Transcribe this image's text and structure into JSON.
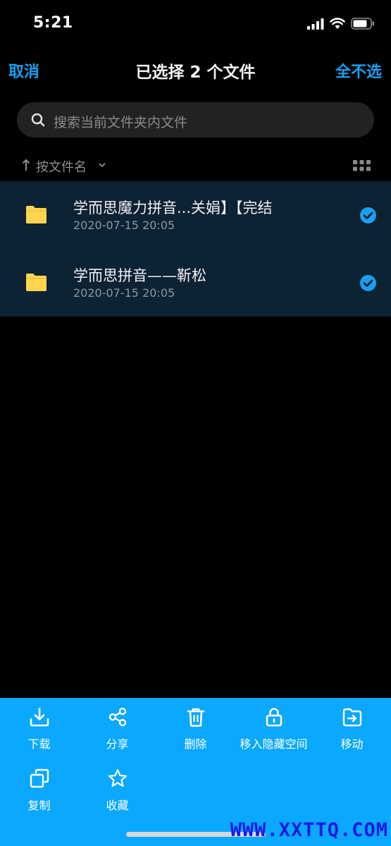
{
  "status_bar": {
    "time": "5:21"
  },
  "nav": {
    "cancel_label": "取消",
    "title": "已选择 2 个文件",
    "deselect_all_label": "全不选"
  },
  "search": {
    "placeholder": "搜索当前文件夹内文件"
  },
  "sort": {
    "label": "按文件名",
    "direction": "ascending"
  },
  "files": [
    {
      "name": "学而思魔力拼音...关娟】【完结",
      "date": "2020-07-15 20:05",
      "type": "folder",
      "selected": true
    },
    {
      "name": "学而思拼音——靳松",
      "date": "2020-07-15 20:05",
      "type": "folder",
      "selected": true
    }
  ],
  "toolbar": {
    "items": [
      {
        "label": "下载",
        "icon": "download-icon"
      },
      {
        "label": "分享",
        "icon": "share-icon"
      },
      {
        "label": "删除",
        "icon": "trash-icon"
      },
      {
        "label": "移入隐藏空间",
        "icon": "lock-icon"
      },
      {
        "label": "移动",
        "icon": "move-icon"
      },
      {
        "label": "复制",
        "icon": "copy-icon"
      },
      {
        "label": "收藏",
        "icon": "star-icon"
      }
    ]
  },
  "watermark": "WWW.XXTTQ.COM",
  "colors": {
    "accent": "#1a9ff2",
    "toolbar_bg": "#0aa8fe",
    "selected_row_bg": "#0d2233",
    "folder": "#ffd54f"
  }
}
